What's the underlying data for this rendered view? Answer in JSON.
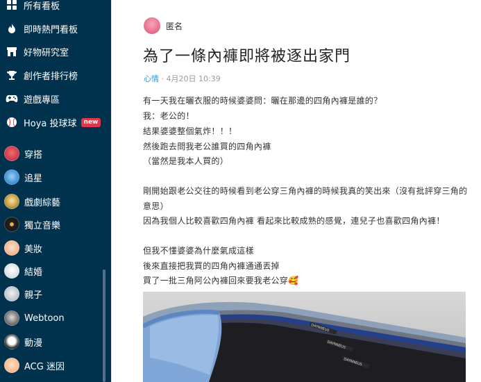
{
  "sidebar": {
    "items": [
      {
        "label": "所有看板",
        "icon": "board-icon"
      },
      {
        "label": "即時熱門看板",
        "icon": "fire-icon"
      },
      {
        "label": "好物研究室",
        "icon": "store-icon"
      },
      {
        "label": "創作者排行榜",
        "icon": "trophy-icon"
      },
      {
        "label": "遊戲專區",
        "icon": "gamepad-icon"
      },
      {
        "label": "Hoya 投球球",
        "icon": "baseball-icon",
        "badge": "new"
      },
      {
        "label": "穿搭",
        "icon": "outfit-avatar"
      },
      {
        "label": "追星",
        "icon": "idol-avatar"
      },
      {
        "label": "戲劇綜藝",
        "icon": "drama-avatar"
      },
      {
        "label": "獨立音樂",
        "icon": "music-avatar"
      },
      {
        "label": "美妝",
        "icon": "makeup-avatar"
      },
      {
        "label": "結婚",
        "icon": "wedding-avatar"
      },
      {
        "label": "親子",
        "icon": "parenting-avatar"
      },
      {
        "label": "Webtoon",
        "icon": "webtoon-avatar"
      },
      {
        "label": "動漫",
        "icon": "anime-avatar"
      },
      {
        "label": "ACG 迷因",
        "icon": "acg-avatar"
      }
    ]
  },
  "post": {
    "author": "匿名",
    "title": "為了一條內褲即將被逐出家門",
    "board": "心情",
    "date": "4月20日 10:39",
    "body": [
      "有一天我在曬衣服的時候婆婆問：曬在那邊的四角內褲是誰的？",
      "我：老公的！",
      "結果婆婆整個氣炸！！！",
      "然後跑去問我老公誰買的四角內褲",
      "（當然是我本人買的）",
      "",
      "剛開始跟老公交往的時候看到老公穿三角內褲的時候我真的笑出來（沒有批評穿三角的",
      "意思）",
      "因為我個人比較喜歡四角內褲 看起來比較成熟的感覺，連兒子也喜歡四角內褲！",
      "",
      "但我不懂婆婆為什麼氣成這樣",
      "後來直接把我買的四角內褲通通丟掉",
      "買了一批三角阿公內褲回來要我老公穿🥰"
    ],
    "photo_band_text": "DAYNNEUS"
  },
  "colors": {
    "sidebar_bg": "#00324e",
    "badge": "#e0354a",
    "board_link": "#3397cf"
  }
}
